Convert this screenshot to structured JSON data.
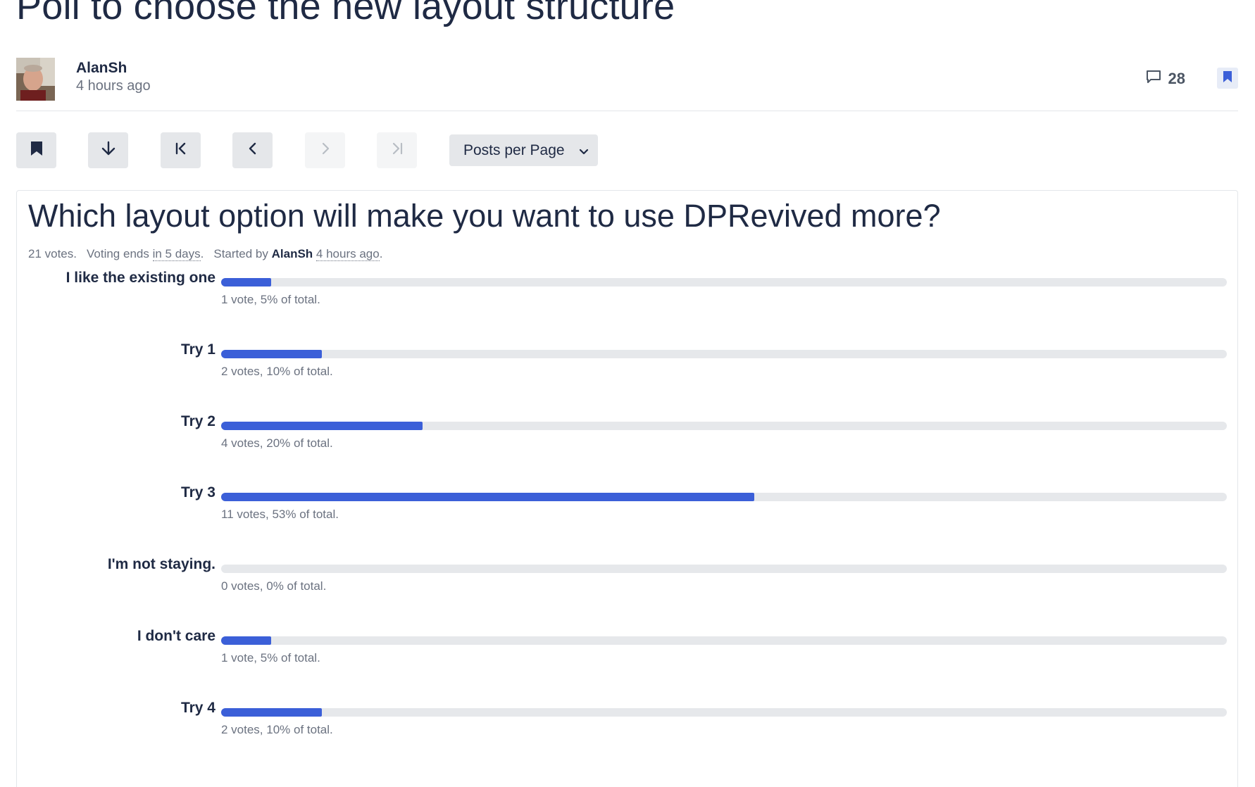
{
  "thread": {
    "title": "Poll to choose the new layout structure"
  },
  "post": {
    "author": "AlanSh",
    "time": "4 hours ago",
    "comment_count": "28",
    "comment_icon": "comment-icon",
    "bookmark_icon": "bookmark-icon"
  },
  "toolbar": {
    "buttons": [
      {
        "icon": "bookmark-icon",
        "enabled": true
      },
      {
        "icon": "arrow-down-icon",
        "enabled": true
      },
      {
        "icon": "first-page-icon",
        "enabled": true
      },
      {
        "icon": "previous-page-icon",
        "enabled": true
      },
      {
        "icon": "next-page-icon",
        "enabled": false
      },
      {
        "icon": "last-page-icon",
        "enabled": false
      }
    ],
    "posts_per_page_label": "Posts per Page"
  },
  "poll": {
    "question": "Which layout option will make you want to use DPRevived more?",
    "votes": "21 votes.",
    "voting_ends_prefix": "Voting ends",
    "voting_ends_value": "in 5 days",
    "voting_ends_suffix": ".",
    "started_by_prefix": "Started by",
    "started_by_author": "AlanSh",
    "started_time": "4 hours ago",
    "started_suffix": ".",
    "accent_color": "#3b5fd8",
    "options": [
      {
        "label": "I like the existing one",
        "fraction": 0.05,
        "result": "1 vote, 5% of total."
      },
      {
        "label": "Try 1",
        "fraction": 0.1,
        "result": "2 votes, 10% of total."
      },
      {
        "label": "Try 2",
        "fraction": 0.2,
        "result": "4 votes, 20% of total."
      },
      {
        "label": "Try 3",
        "fraction": 0.53,
        "result": "11 votes, 53% of total."
      },
      {
        "label": "I'm not staying.",
        "fraction": 0.0,
        "result": "0 votes, 0% of total."
      },
      {
        "label": "I don't care",
        "fraction": 0.05,
        "result": "1 vote, 5% of total."
      },
      {
        "label": "Try 4",
        "fraction": 0.1,
        "result": "2 votes, 10% of total."
      }
    ]
  }
}
